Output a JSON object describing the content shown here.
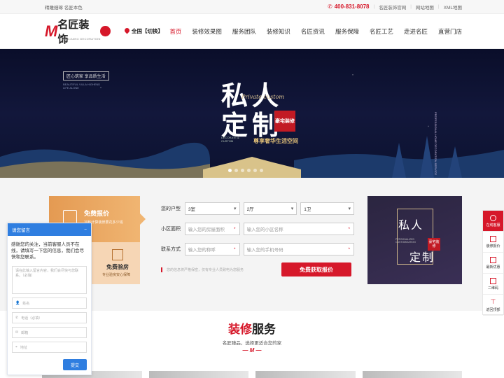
{
  "topbar": {
    "tagline": "精雕细琢 名匠本色",
    "phone": "400-831-8078",
    "links": [
      "名匠装饰官网",
      "网站地图",
      "XML地图"
    ]
  },
  "header": {
    "logo_name": "名匠装饰",
    "logo_sub": "MINGJIANG DECORATION",
    "city": "全国【切换】",
    "nav": [
      "首页",
      "装修效果图",
      "服务团队",
      "装修知识",
      "名匠资讯",
      "服务保障",
      "名匠工艺",
      "走进名匠",
      "直营门店"
    ]
  },
  "banner": {
    "tag": "匠心筑家 享品质生活",
    "tag_sub": "BEAUTIFUL VILLA HIGHEND LIFE ALONE",
    "title_line1": "私人",
    "title_line2": "定制",
    "script": "Private custom",
    "stamp": "豪宅装修",
    "slogan": "尊享奢华生活空间",
    "small": "DECORATE & CUSTOM",
    "vertical": "PROFESSIONAL HOME DECORATION SERVICE",
    "slide_count": 6,
    "active_slide": 0
  },
  "quote": {
    "card_top_title": "免费报价",
    "card_top_sub": "30秒计算装修要花多少钱",
    "card_bottom_title": "免费验房",
    "card_bottom_sub": "专业验房安心保障",
    "form": {
      "house_label": "您的户型",
      "rooms": "3室",
      "halls": "2厅",
      "baths": "1卫",
      "area_label": "小区面积",
      "area_placeholder": "输入您的房屋面积",
      "community_placeholder": "输入您的小区名称",
      "contact_label": "联系方式",
      "name_placeholder": "输入您的称呼",
      "phone_placeholder": "输入您的手机号码",
      "note": "您的信息将严格保密，仅有专业人员致电为您服务",
      "submit": "免费获取报价"
    },
    "promo": {
      "line1": "私人",
      "line2": "定制",
      "stamp": "豪宅装修",
      "small": "PERSONALIZED CUSTOMIZATION"
    }
  },
  "service": {
    "title_red": "装修",
    "title_black": "服务",
    "subtitle": "名匠臻品，选择更适合您的家"
  },
  "chat": {
    "header": "请您留言",
    "close": "−",
    "intro": "感谢您的关注，当前客服人员不在线，请填写一下您的信息，我们会尽快和您联系。",
    "textarea_placeholder": "请在此输入留言内容，我们会尽快与您联系。（必填）",
    "fields": [
      "姓名",
      "电话（必填）",
      "邮箱",
      "地址"
    ],
    "submit": "提交"
  },
  "sidebar": [
    "在线客服",
    "装修报价",
    "最新优惠",
    "二维码",
    "返回顶部"
  ]
}
